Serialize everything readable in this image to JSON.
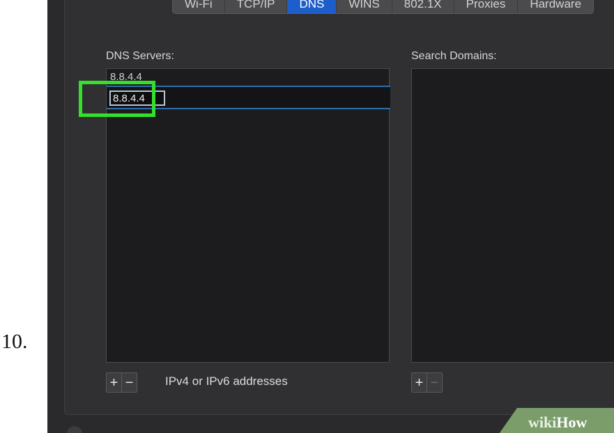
{
  "step": {
    "number": "10."
  },
  "tabs": [
    {
      "label": "Wi-Fi",
      "active": false
    },
    {
      "label": "TCP/IP",
      "active": false
    },
    {
      "label": "DNS",
      "active": true
    },
    {
      "label": "WINS",
      "active": false
    },
    {
      "label": "802.1X",
      "active": false
    },
    {
      "label": "Proxies",
      "active": false
    },
    {
      "label": "Hardware",
      "active": false
    }
  ],
  "dns_servers": {
    "label": "DNS Servers:",
    "entries": [
      "8.8.4.4"
    ],
    "editing_value": "8.8.4.4",
    "add_label": "+",
    "remove_label": "−",
    "hint": "IPv4 or IPv6 addresses"
  },
  "search_domains": {
    "label": "Search Domains:",
    "entries": [],
    "add_label": "+",
    "remove_label": "−"
  },
  "watermark": {
    "wiki": "wiki",
    "how": "How"
  },
  "colors": {
    "accent": "#1e5ecb",
    "highlight": "#35e02a",
    "panel_bg": "#303032",
    "list_bg": "#1c1c1e"
  }
}
